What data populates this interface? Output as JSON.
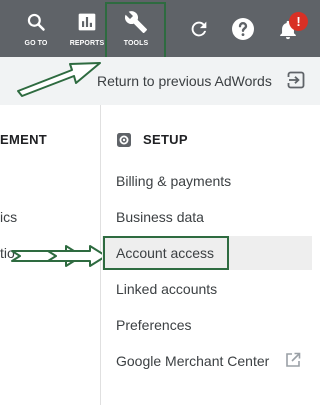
{
  "toolbar": {
    "goto_label": "GO TO",
    "reports_label": "REPORTS",
    "tools_label": "TOOLS",
    "notification_count": "!",
    "icons": [
      "search-icon",
      "bar-chart-icon",
      "wrench-icon",
      "refresh-icon",
      "help-icon",
      "bell-icon"
    ]
  },
  "return_bar": {
    "text": "Return to previous AdWords",
    "icon": "exit-icon"
  },
  "left_column": {
    "heading": "EMENT",
    "items": [
      "ics",
      "tio"
    ]
  },
  "setup": {
    "title": "SETUP",
    "icon": "gear-icon",
    "items": [
      "Billing & payments",
      "Business data",
      "Account access",
      "Linked accounts",
      "Preferences",
      "Google Merchant Center"
    ],
    "active_item": "Account access",
    "external_icon": "open-external-icon"
  },
  "colors": {
    "toolbar_bg": "#5f6368",
    "return_bar_bg": "#f1f3f4",
    "highlight_box": "#2e6b40",
    "badge": "#d93025",
    "active_row": "#eeeeee"
  }
}
